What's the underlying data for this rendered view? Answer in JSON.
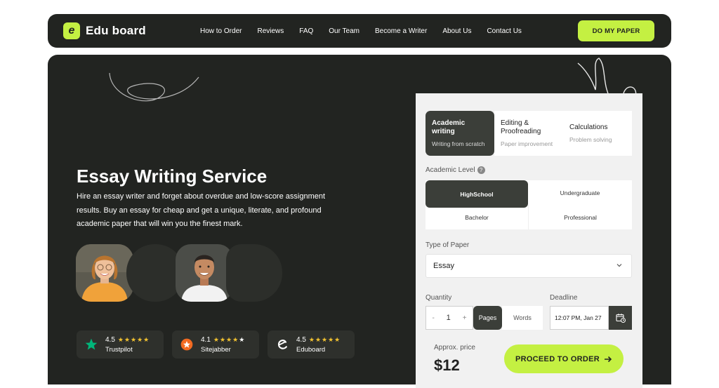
{
  "brand": {
    "logo_letter": "e",
    "name": "Edu board",
    "accent": "#c4f042",
    "dark": "#222421"
  },
  "nav": {
    "links": [
      "How to Order",
      "Reviews",
      "FAQ",
      "Our Team",
      "Become a Writer",
      "About Us",
      "Contact Us"
    ],
    "cta": "DO MY PAPER"
  },
  "hero": {
    "title": "Essay Writing Service",
    "description": "Hire an essay writer and forget about overdue and low-score assignment results. Buy an essay for cheap and get a unique, literate, and profound academic paper that will win you the finest mark."
  },
  "ratings": [
    {
      "score": "4.5",
      "name": "Trustpilot",
      "icon": "trustpilot-star-icon",
      "full": 5,
      "white": 0
    },
    {
      "score": "4.1",
      "name": "Sitejabber",
      "icon": "sitejabber-icon",
      "full": 4,
      "white": 1
    },
    {
      "score": "4.5",
      "name": "Eduboard",
      "icon": "eduboard-logo-icon",
      "full": 5,
      "white": 0
    }
  ],
  "order": {
    "tabs": [
      {
        "title": "Academic writing",
        "sub": "Writing from scratch"
      },
      {
        "title": "Editing & Proofreading",
        "sub": "Paper improvement"
      },
      {
        "title": "Calculations",
        "sub": "Problem solving"
      }
    ],
    "level_label": "Academic Level",
    "levels": [
      "HighSchool",
      "Undergraduate",
      "Bachelor",
      "Professional"
    ],
    "type_label": "Type of Paper",
    "type_value": "Essay",
    "quantity_label": "Quantity",
    "quantity_minus": "-",
    "quantity_value": "1",
    "quantity_plus": "+",
    "unit_pages": "Pages",
    "unit_words": "Words",
    "deadline_label": "Deadline",
    "deadline_value": "12:07 PM, Jan 27",
    "approx_label": "Approx. price",
    "price": "$12",
    "proceed": "PROCEED TO ORDER"
  }
}
